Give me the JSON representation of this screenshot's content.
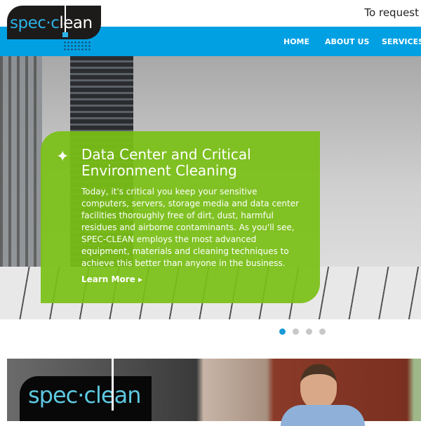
{
  "header": {
    "logo_text_left": "spec·c",
    "logo_text_right": "lean",
    "request_text": "To request",
    "nav": [
      {
        "label": "HOME"
      },
      {
        "label": "ABOUT US"
      },
      {
        "label": "SERVICES"
      }
    ],
    "accent": "#00a0e3"
  },
  "hero": {
    "title": "Data Center and Critical Environment Cleaning",
    "body": "Today, it's critical you keep your sensitive computers, servers, storage media and data center facilities thoroughly free of dirt, dust, harmful residues and airborne contaminants. As you'll see, SPEC-CLEAN employs the most advanced equipment, materials and cleaning techniques to achieve this better than anyone in the business.",
    "cta": "Learn More ▸",
    "icon": "sparkle-icon",
    "panel_color": "#7ac016",
    "carousel": {
      "slides": 4,
      "active": 1
    }
  },
  "video": {
    "logo_text": "spec·clean"
  }
}
